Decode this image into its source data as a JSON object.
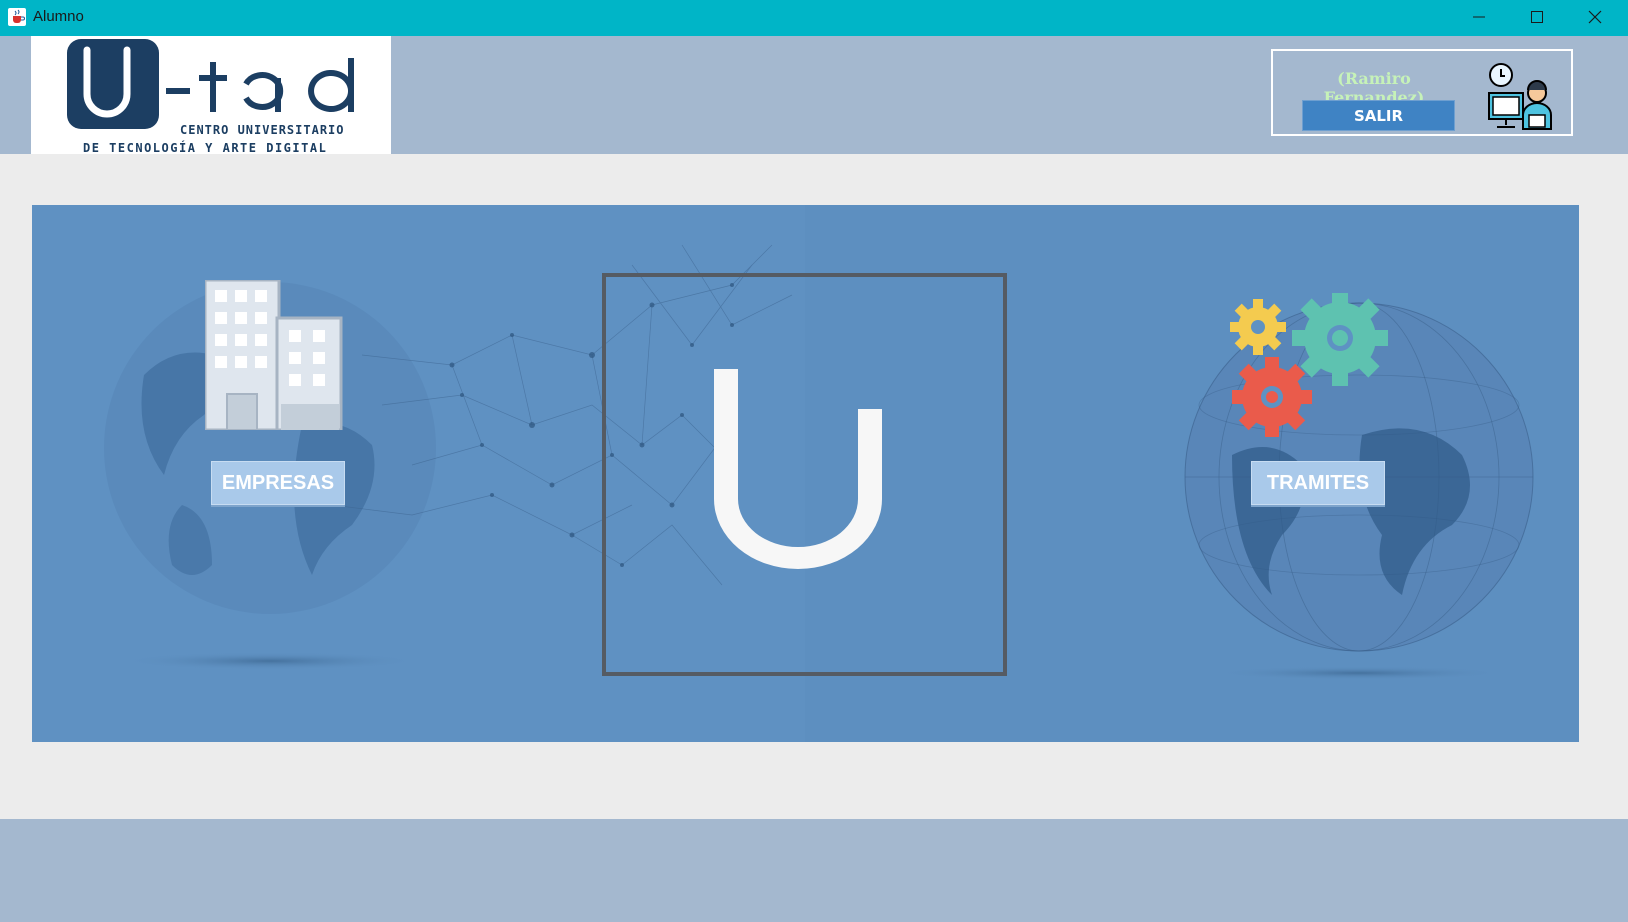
{
  "window": {
    "title": "Alumno",
    "icons": [
      "java-cup-icon",
      "minimize-icon",
      "maximize-icon",
      "close-icon"
    ]
  },
  "header": {
    "logo": {
      "wordmark": "U-tad",
      "line1": "CENTRO UNIVERSITARIO",
      "line2": "DE TECNOLOGÍA Y ARTE DIGITAL"
    },
    "user_name": "(Ramiro Fernandez)",
    "logout_label": "SALIR",
    "avatar_icon": "user-at-computer-icon"
  },
  "main": {
    "empresas_label": "EMPRESAS",
    "tramites_label": "TRAMITES",
    "center_letter": "U",
    "icons": [
      "building-icon",
      "gears-icon",
      "globe-icon"
    ]
  },
  "colors": {
    "titlebar": "#00b5c7",
    "header_bg": "#a4b8cf",
    "content_bg": "#ececec",
    "banner_bg": "#5f91c2",
    "button_bg": "#a9c9ea",
    "logout_bg": "#3f83c4",
    "user_name": "#c6f2b8",
    "logo_blue": "#1c3e62"
  }
}
